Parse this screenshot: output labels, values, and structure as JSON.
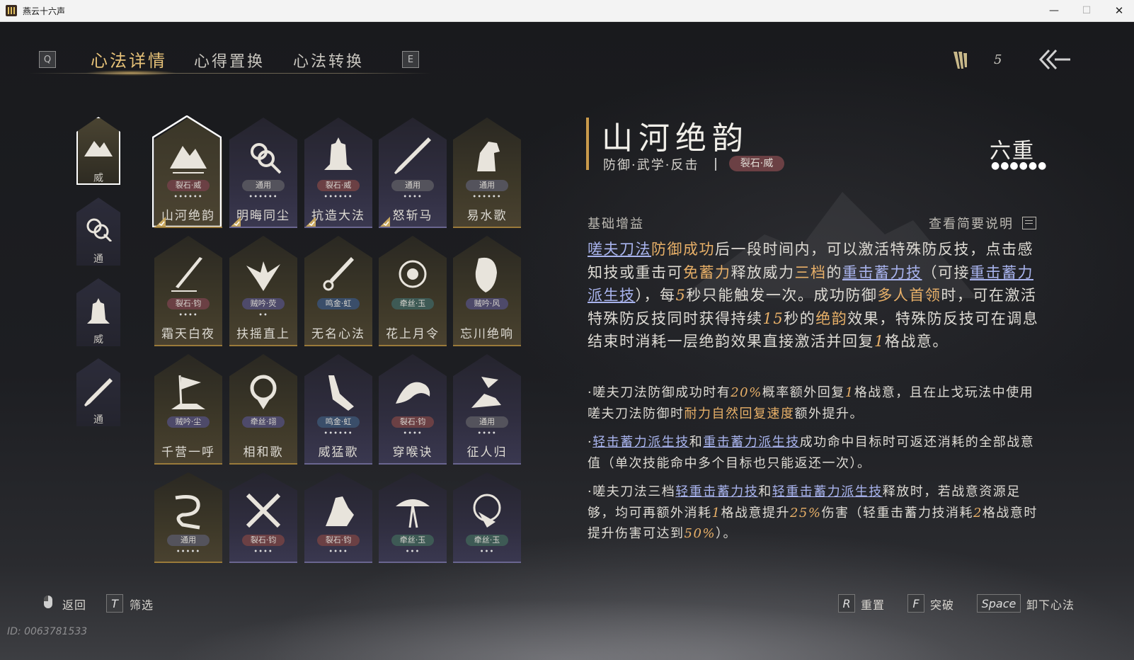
{
  "window": {
    "title": "燕云十六声",
    "minimize": "—",
    "maximize": "☐",
    "close": "✕"
  },
  "nav": {
    "left_key": "Q",
    "right_key": "E",
    "tabs": [
      {
        "label": "心法详情",
        "active": true
      },
      {
        "label": "心得置换",
        "active": false
      },
      {
        "label": "心法转换",
        "active": false
      }
    ],
    "token_count": "5",
    "back_icon": "back-arrow-icon"
  },
  "categories": [
    {
      "label": "威",
      "icon": "mountain-icon",
      "active": true
    },
    {
      "label": "通",
      "icon": "knot-icon",
      "active": false
    },
    {
      "label": "威",
      "icon": "bell-icon",
      "active": false
    },
    {
      "label": "通",
      "icon": "blade-icon",
      "active": false
    }
  ],
  "cards": [
    {
      "name": "山河绝韵",
      "badge": "裂石·威",
      "badge_color": "red",
      "dots": "••••••",
      "tone": "gold",
      "icon": "mountain-icon",
      "equipped": true,
      "selected": true
    },
    {
      "name": "明晦同尘",
      "badge": "通用",
      "badge_color": "gray",
      "dots": "••••••",
      "tone": "purple",
      "icon": "knot-icon",
      "equipped": true
    },
    {
      "name": "抗造大法",
      "badge": "裂石·威",
      "badge_color": "red",
      "dots": "••••••",
      "tone": "purple",
      "icon": "bell-icon",
      "equipped": true
    },
    {
      "name": "怒斩马",
      "badge": "通用",
      "badge_color": "gray",
      "dots": "••••",
      "tone": "purple",
      "icon": "blade-icon",
      "equipped": true
    },
    {
      "name": "易水歌",
      "badge": "通用",
      "badge_color": "gray",
      "dots": "••••••",
      "tone": "gold",
      "icon": "horse-icon"
    },
    {
      "name": "霜天白夜",
      "badge": "裂石·钧",
      "badge_color": "red",
      "dots": "••••",
      "tone": "gold",
      "icon": "spear-icon"
    },
    {
      "name": "扶摇直上",
      "badge": "贼吟·荧",
      "badge_color": "purple",
      "dots": "••",
      "tone": "gold",
      "icon": "eagle-icon"
    },
    {
      "name": "无名心法",
      "badge": "鸣金·虹",
      "badge_color": "blue",
      "dots": "",
      "tone": "gold",
      "icon": "sword-icon"
    },
    {
      "name": "花上月令",
      "badge": "牵丝·玉",
      "badge_color": "green",
      "dots": "",
      "tone": "gold",
      "icon": "flower-icon"
    },
    {
      "name": "忘川绝响",
      "badge": "贼吟·风",
      "badge_color": "purple",
      "dots": "",
      "tone": "gold",
      "icon": "mask-icon"
    },
    {
      "name": "千营一呼",
      "badge": "贼吟·尘",
      "badge_color": "purple",
      "dots": "",
      "tone": "gold",
      "icon": "flag-icon"
    },
    {
      "name": "相和歌",
      "badge": "牵丝·翊",
      "badge_color": "purple",
      "dots": "",
      "tone": "gold",
      "icon": "ram-icon"
    },
    {
      "name": "威猛歌",
      "badge": "鸣金·虹",
      "badge_color": "blue",
      "dots": "••••••",
      "tone": "purple",
      "icon": "hand-icon"
    },
    {
      "name": "穿喉诀",
      "badge": "裂石·钧",
      "badge_color": "red",
      "dots": "••••",
      "tone": "purple",
      "icon": "wave-icon"
    },
    {
      "name": "征人归",
      "badge": "通用",
      "badge_color": "gray",
      "dots": "••••",
      "tone": "purple",
      "icon": "bird-hand-icon"
    },
    {
      "name": "",
      "badge": "通用",
      "badge_color": "gray",
      "dots": "•••••",
      "tone": "gold",
      "icon": "dragon-icon"
    },
    {
      "name": "",
      "badge": "裂石·钧",
      "badge_color": "red",
      "dots": "••••",
      "tone": "purple",
      "icon": "crossed-blades-icon"
    },
    {
      "name": "",
      "badge": "裂石·钧",
      "badge_color": "red",
      "dots": "••••",
      "tone": "purple",
      "icon": "horse-rider-icon"
    },
    {
      "name": "",
      "badge": "牵丝·玉",
      "badge_color": "green",
      "dots": "•••",
      "tone": "purple",
      "icon": "tree-icon"
    },
    {
      "name": "",
      "badge": "牵丝·玉",
      "badge_color": "green",
      "dots": "•••",
      "tone": "purple",
      "icon": "swirl-hand-icon"
    }
  ],
  "detail": {
    "title": "山河绝韵",
    "tags": "防御·武学·反击",
    "badge": "裂石·威",
    "level": "六重",
    "level_dots": "●●●●●●",
    "section": "基础增益",
    "help": "查看简要说明"
  },
  "bottom": {
    "back": "返回",
    "filter_key": "T",
    "filter": "筛选",
    "reset_key": "R",
    "reset": "重置",
    "break_key": "F",
    "break": "突破",
    "unequip_key": "Space",
    "unequip": "卸下心法",
    "id": "ID: 0063781533"
  },
  "colors": {
    "accent_gold": "#e6c178",
    "link": "#a9b4ee",
    "highlight": "#e8b068",
    "badge_red": "#6b4044"
  }
}
